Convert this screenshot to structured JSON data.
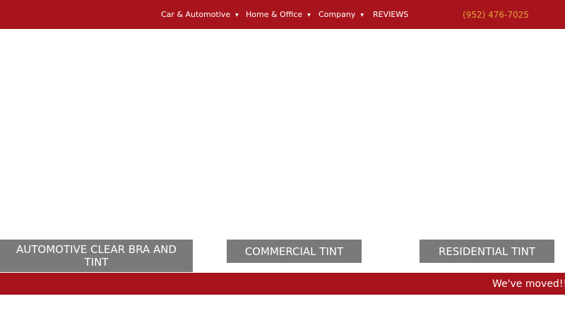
{
  "header": {
    "nav": [
      {
        "label": "Car & Automotive",
        "has_dropdown": true
      },
      {
        "label": "Home & Office",
        "has_dropdown": true
      },
      {
        "label": "Company",
        "has_dropdown": true
      },
      {
        "label": "REVIEWS",
        "has_dropdown": false
      }
    ],
    "phone": "(952) 476-7025",
    "caret_glyph": "▼"
  },
  "services": [
    {
      "label": "AUTOMOTIVE CLEAR BRA AND TINT"
    },
    {
      "label": "COMMERCIAL TINT"
    },
    {
      "label": "RESIDENTIAL TINT"
    }
  ],
  "banner": {
    "text": "We've moved!! C"
  },
  "colors": {
    "brand_red": "#a8141c",
    "button_gray": "#7a7a78",
    "phone_gold": "#e0a23a"
  }
}
